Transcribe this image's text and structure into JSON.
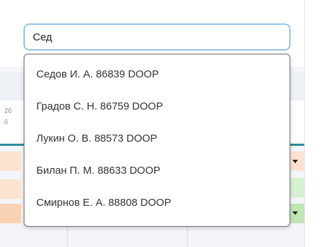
{
  "search": {
    "value": "Сед",
    "placeholder": ""
  },
  "suggestions": [
    "Седов И. А. 86839 DOOP",
    "Градов С. Н. 86759 DOOP",
    "Лукин О. В. 88573 DOOP",
    "Билан П. М. 88633 DOOP",
    "Смирнов Е. А. 88808 DOOP"
  ],
  "background": {
    "partial_dates": [
      "26",
      "6"
    ]
  },
  "colors": {
    "accent": "#3b8fd4",
    "teal": "#2b8b9a",
    "orange_cell": "#fde3cf",
    "green_cell": "#d7f0d2"
  }
}
